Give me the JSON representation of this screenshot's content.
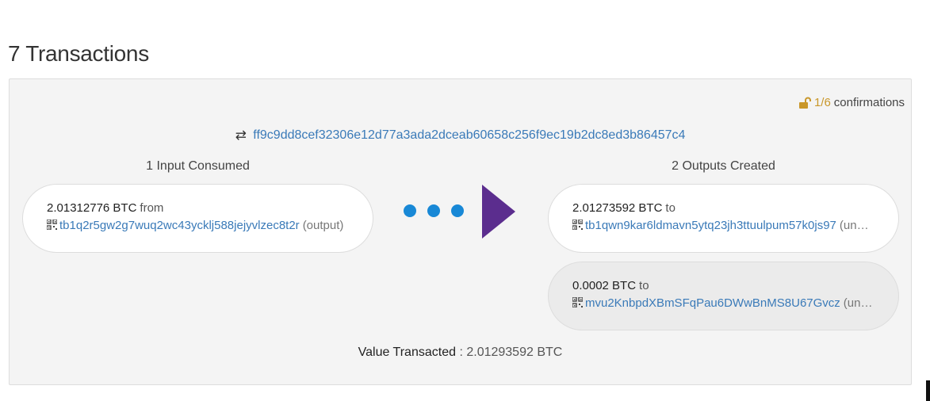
{
  "page_title": "7 Transactions",
  "transaction": {
    "confirmations": {
      "count": "1/6",
      "label": "confirmations"
    },
    "txid": "ff9c9dd8cef32306e12d77a3ada2dceab60658c256f9ec19b2dc8ed3b86457c4",
    "inputs": {
      "heading": "1 Input Consumed",
      "items": [
        {
          "amount": "2.01312776 BTC",
          "direction": "from",
          "address": "tb1q2r5gw2g7wuq2wc43ycklj588jejyvlzec8t2r",
          "status": "(output)"
        }
      ]
    },
    "outputs": {
      "heading": "2 Outputs Created",
      "items": [
        {
          "amount": "2.01273592 BTC",
          "direction": "to",
          "address": "tb1qwn9kar6ldmavn5ytq23jh3ttuulpum57k0js97",
          "status": "(unspent)"
        },
        {
          "amount": "0.0002 BTC",
          "direction": "to",
          "address": "mvu2KnbpdXBmSFqPau6DWwBnMS8U67Gvcz",
          "status": "(unspent)"
        }
      ]
    },
    "value_transacted": {
      "label": "Value Transacted",
      "value": ": 2.01293592 BTC"
    }
  },
  "colors": {
    "link": "#3a7ab8",
    "dots": "#1888d6",
    "arrow": "#5b2d8e",
    "confirmation_count": "#c9972a"
  }
}
